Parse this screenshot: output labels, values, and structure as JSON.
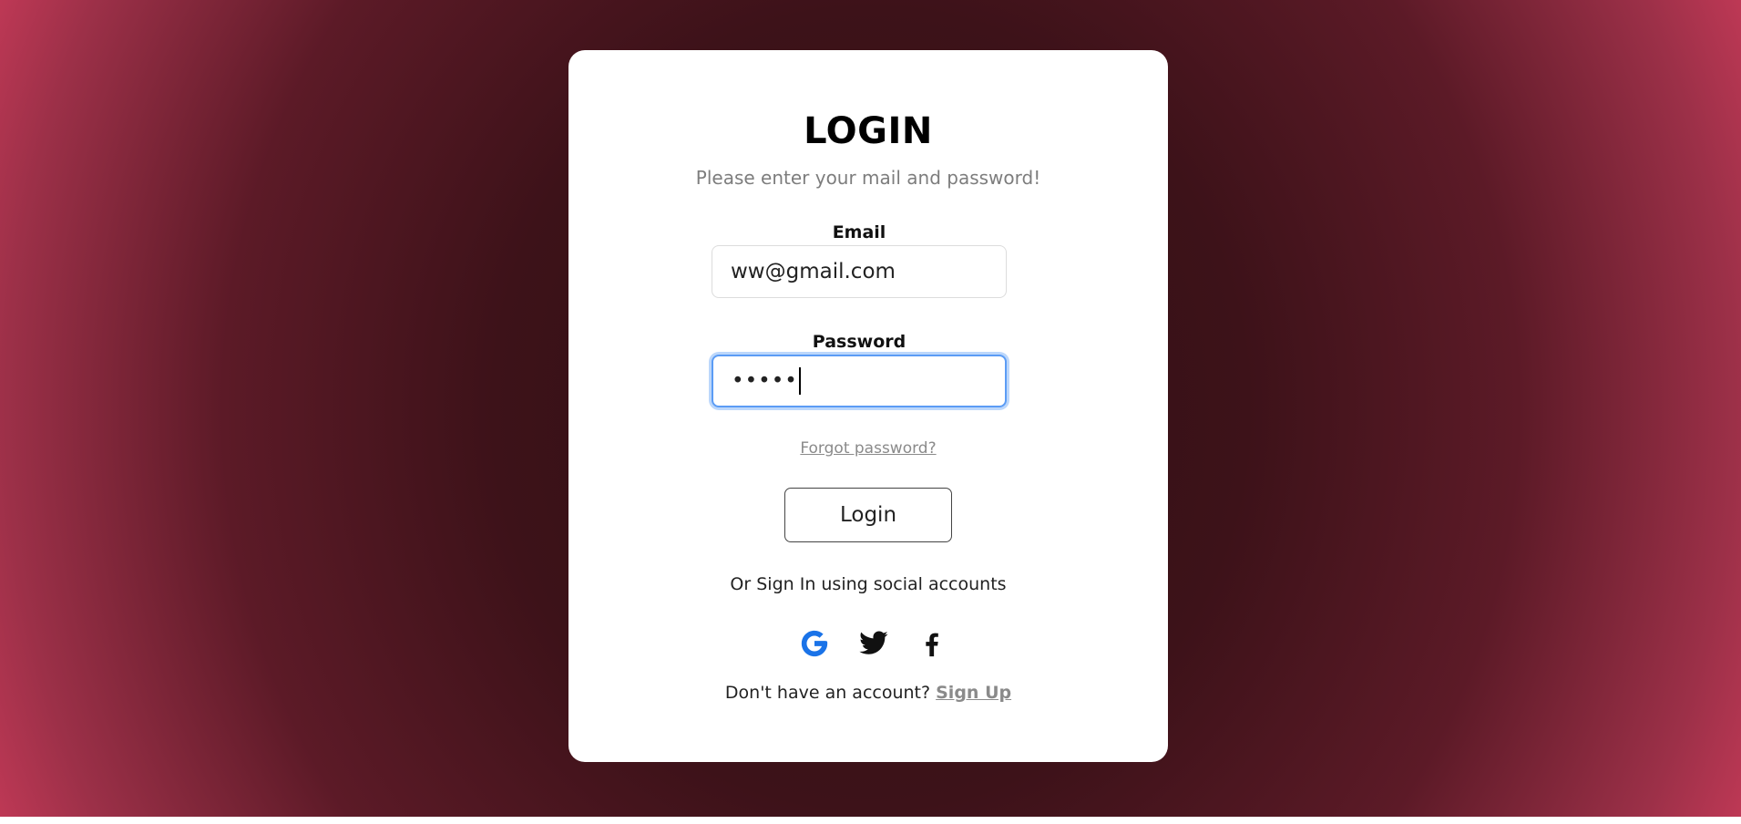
{
  "login": {
    "title": "LOGIN",
    "subtitle": "Please enter your mail and password!",
    "email_label": "Email",
    "email_value": "ww@gmail.com",
    "password_label": "Password",
    "password_masked": "•••••",
    "forgot_link": "Forgot password?",
    "login_button": "Login",
    "social_text": "Or Sign In using social accounts",
    "social_icons": [
      "google-icon",
      "twitter-icon",
      "facebook-icon"
    ],
    "signup_prompt": "Don't have an account?",
    "signup_link": "Sign Up"
  },
  "colors": {
    "background_center": "#2e0e13",
    "background_edge": "#ee4468",
    "card": "#ffffff",
    "focus_ring": "#5b9cf5",
    "google_blue": "#1a73e8"
  }
}
